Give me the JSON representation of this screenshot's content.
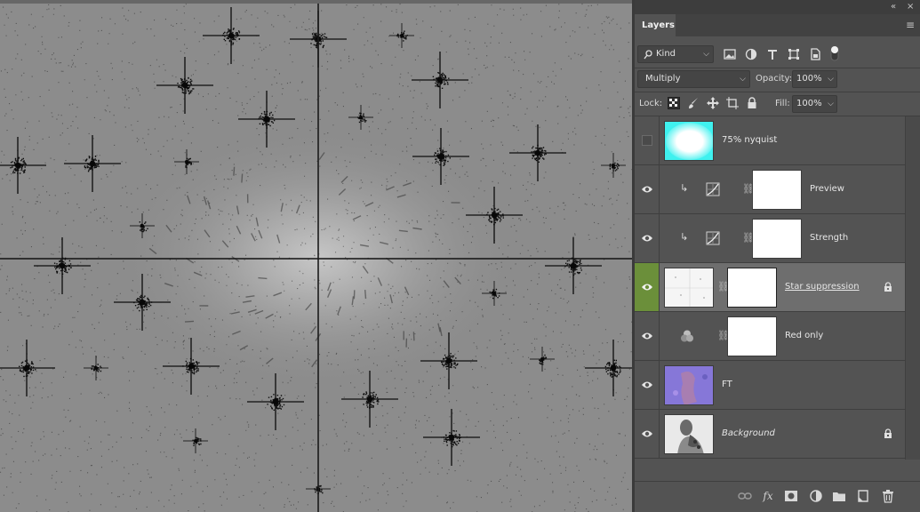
{
  "panel": {
    "collapse_icon": "«",
    "close_icon": "×",
    "tab_label": "Layers",
    "menu_icon": "≡"
  },
  "filter": {
    "kind_label": "Kind",
    "icons": [
      "image-filter-icon",
      "adjustment-filter-icon",
      "type-filter-icon",
      "shape-filter-icon",
      "smart-object-filter-icon",
      "filter-toggle"
    ]
  },
  "blend": {
    "mode": "Multiply",
    "opacity_label": "Opacity:",
    "opacity_value": "100%"
  },
  "lock": {
    "label": "Lock:",
    "fill_label": "Fill:",
    "fill_value": "100%"
  },
  "layers": [
    {
      "name": "75% nyquist",
      "visible": false,
      "type": "pixel",
      "thumb": "cyan-ellipse"
    },
    {
      "name": "Preview",
      "visible": true,
      "type": "curves-clipped",
      "thumb": "white-mask"
    },
    {
      "name": "Strength",
      "visible": true,
      "type": "curves-clipped",
      "thumb": "white-mask"
    },
    {
      "name": "Star suppression",
      "visible": true,
      "type": "pixel-with-mask",
      "selected": true,
      "locked": true
    },
    {
      "name": "Red only",
      "visible": true,
      "type": "channel-mixer",
      "thumb": "white-mask"
    },
    {
      "name": "FT",
      "visible": true,
      "type": "pixel",
      "thumb": "purple-noise"
    },
    {
      "name": "Background",
      "visible": true,
      "type": "pixel",
      "thumb": "portrait",
      "locked": true,
      "italic": true
    }
  ],
  "bottom": {
    "icons": [
      "link-layers-icon",
      "fx-icon",
      "add-mask-icon",
      "new-adjustment-icon",
      "new-group-icon",
      "new-layer-icon",
      "delete-icon"
    ],
    "fx_label": "fx"
  }
}
